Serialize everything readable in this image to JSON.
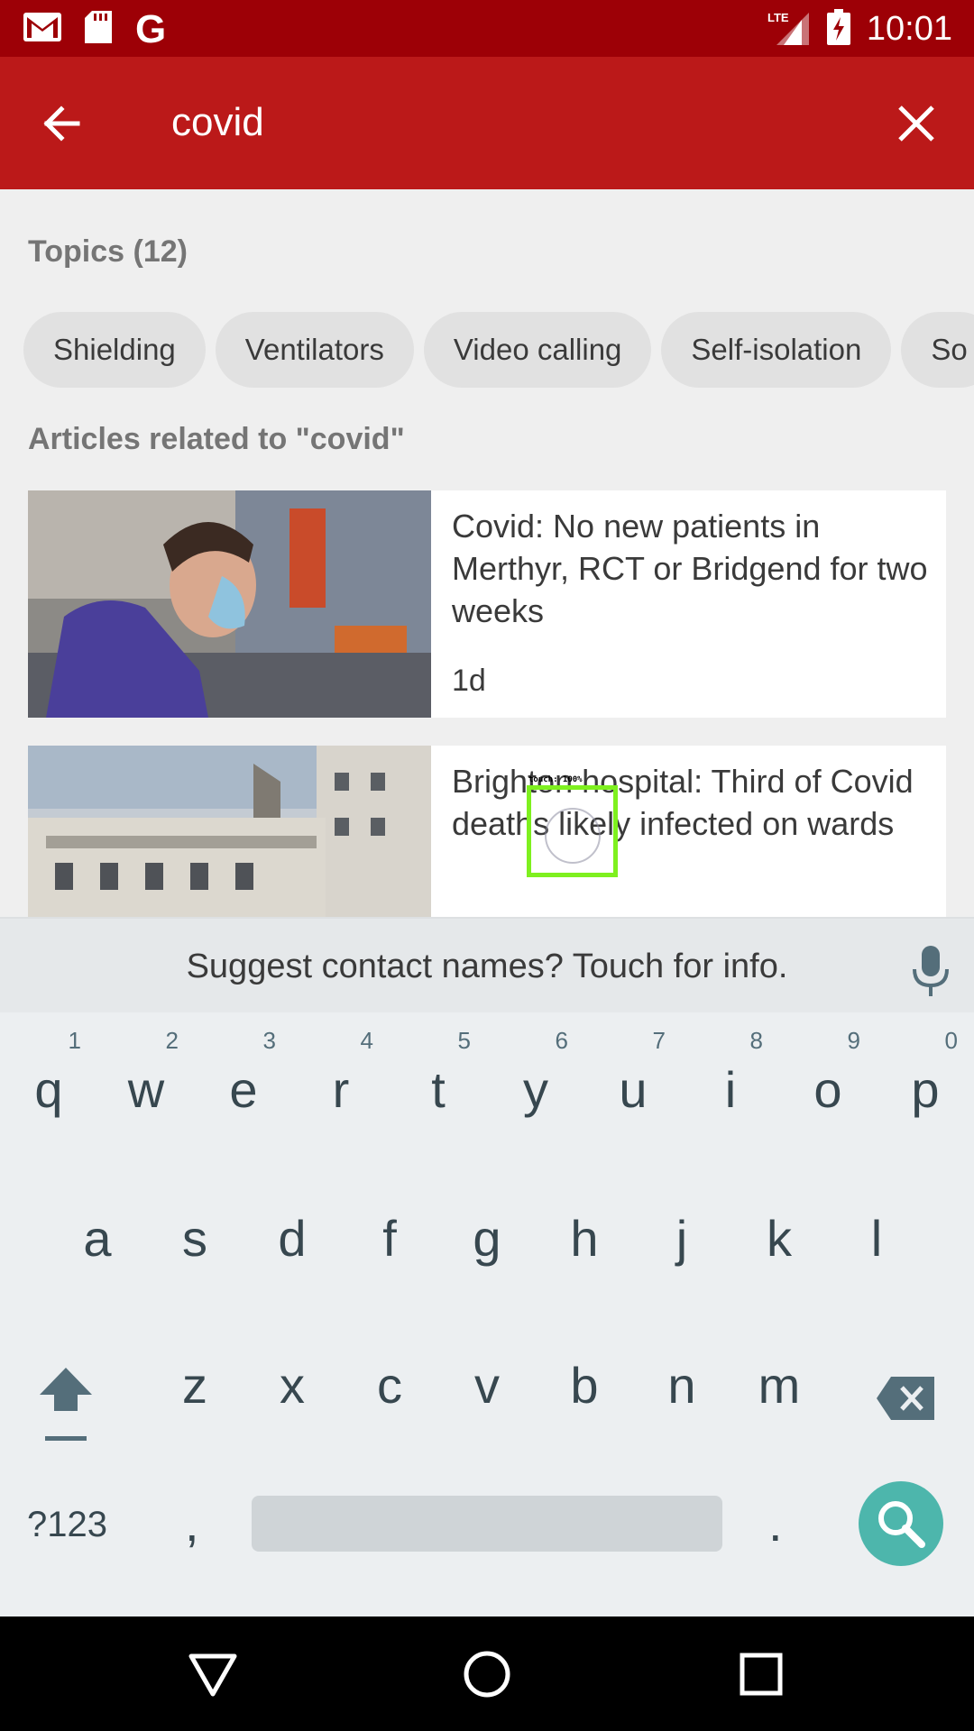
{
  "status_bar": {
    "time": "10:01",
    "network": "LTE",
    "notification_icons": [
      "gmail-icon",
      "sd-card-icon",
      "google-icon"
    ],
    "google_letter": "G"
  },
  "search": {
    "query": "covid",
    "back_icon": "arrow-left-icon",
    "clear_icon": "close-icon"
  },
  "topics": {
    "title": "Topics (12)",
    "chips": [
      "Shielding",
      "Ventilators",
      "Video calling",
      "Self-isolation",
      "So"
    ]
  },
  "articles": {
    "title": "Articles related to \"covid\"",
    "items": [
      {
        "headline": "Covid: No new patients in Merthyr, RCT or Bridgend for two weeks",
        "age": "1d"
      },
      {
        "headline": "Brighton hospital: Third of Covid deaths likely infected on wards",
        "age": ""
      }
    ]
  },
  "touch_overlay": {
    "label": "touch: 100%"
  },
  "keyboard": {
    "suggestion": "Suggest contact names? Touch for info.",
    "row1": [
      "q",
      "w",
      "e",
      "r",
      "t",
      "y",
      "u",
      "i",
      "o",
      "p"
    ],
    "row1_hints": [
      "1",
      "2",
      "3",
      "4",
      "5",
      "6",
      "7",
      "8",
      "9",
      "0"
    ],
    "row2": [
      "a",
      "s",
      "d",
      "f",
      "g",
      "h",
      "j",
      "k",
      "l"
    ],
    "row3": [
      "z",
      "x",
      "c",
      "v",
      "b",
      "n",
      "m"
    ],
    "symbols_label": "?123",
    "comma": ",",
    "period": ".",
    "accent_color": "#4db6ac"
  },
  "colors": {
    "status_bar": "#9d0006",
    "app_bar": "#bb1919"
  }
}
